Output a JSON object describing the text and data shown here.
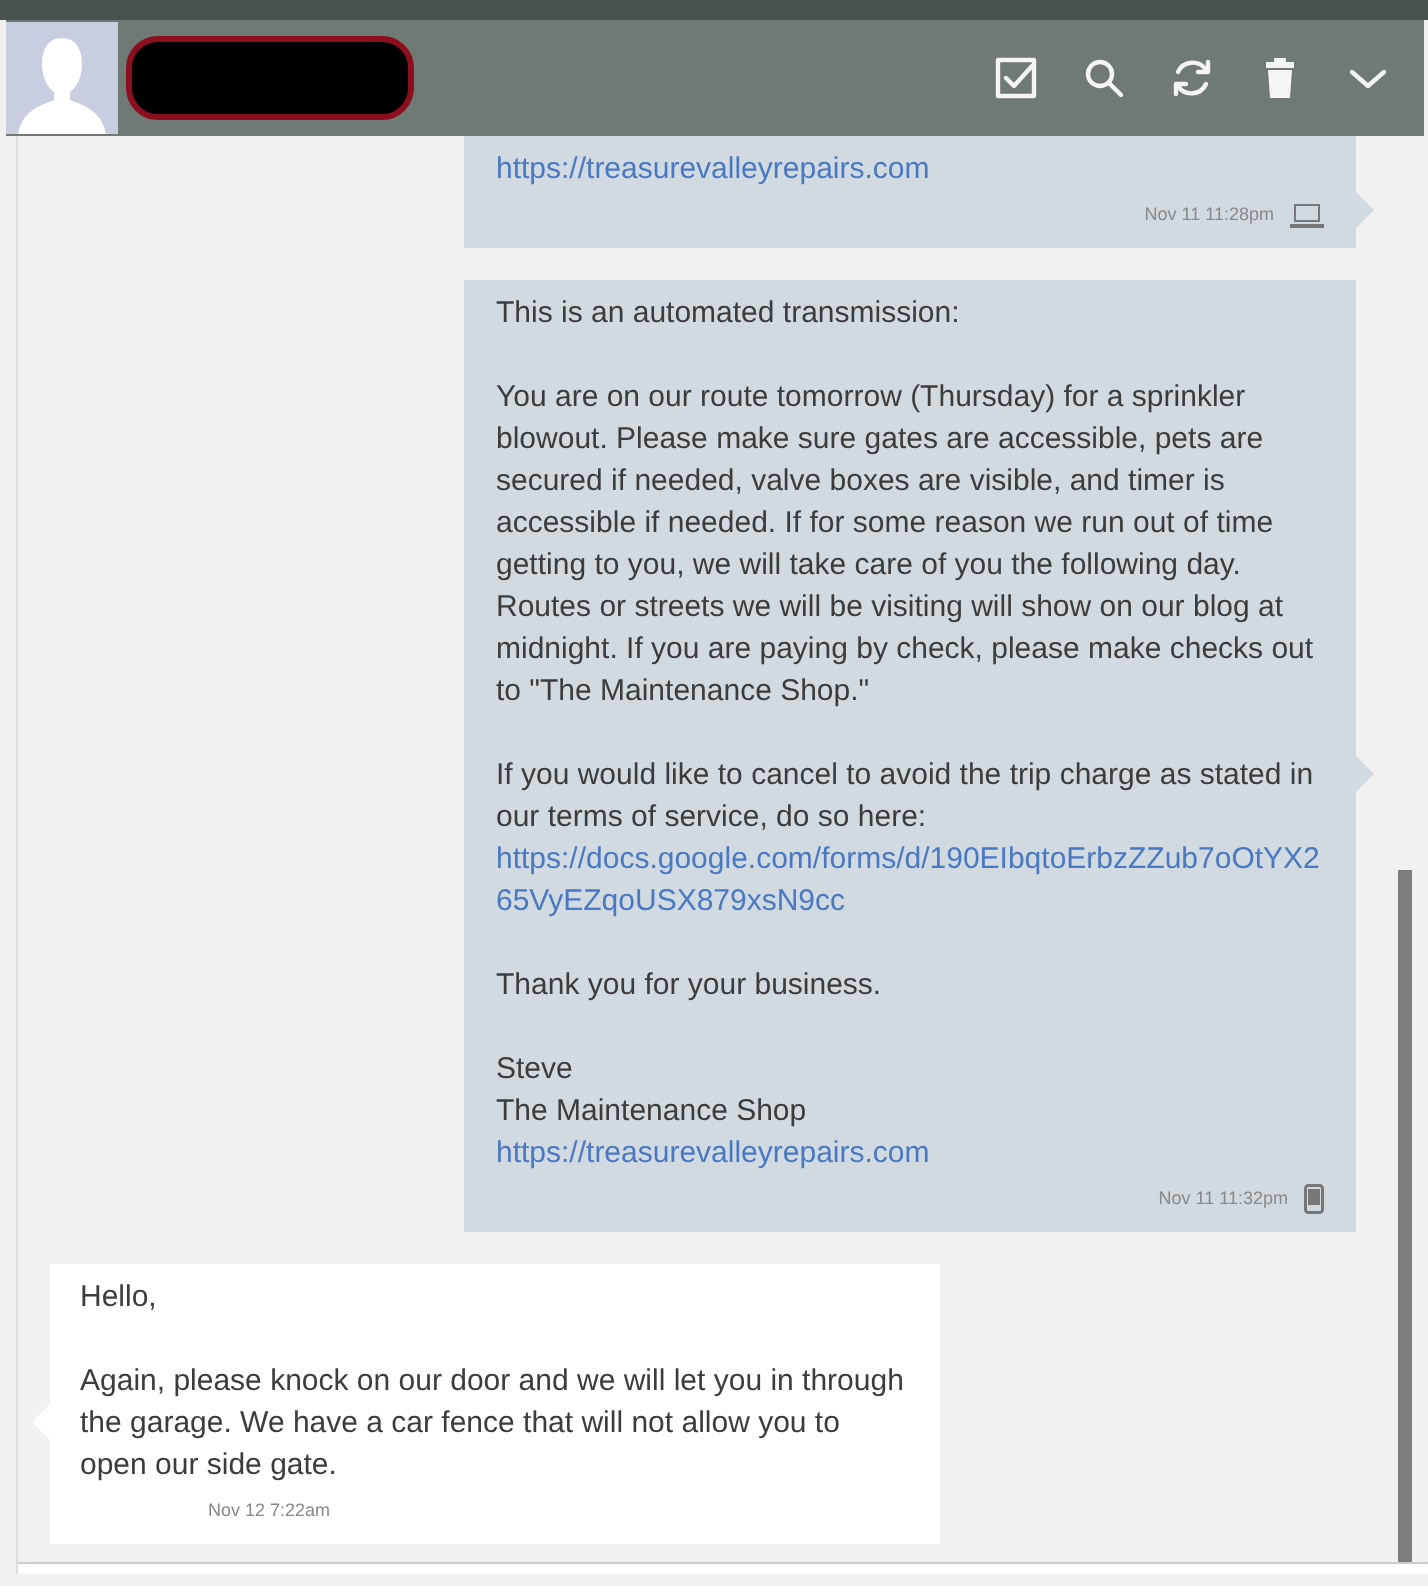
{
  "messages": [
    {
      "sent": true,
      "kind": "laptop",
      "paragraphs": [
        [
          {
            "kind": "link",
            "text": "https://treasurevalleyrepairs.com"
          }
        ]
      ],
      "time": "Nov 11 11:28pm"
    },
    {
      "sent": true,
      "kind": "phone",
      "paragraphs": [
        [
          {
            "kind": "text",
            "text": "This is an automated transmission:"
          }
        ],
        [
          {
            "kind": "text",
            "text": "You are on our route tomorrow (Thursday) for a sprinkler blowout. Please make sure gates are accessible, pets are secured if needed, valve boxes are visible, and timer is accessible if needed. If for some reason we run out of time getting to you, we will take care of you the following day. Routes or streets we will be visiting will show on our blog at midnight. If you are paying by check, please make checks out to \"The Maintenance Shop.\""
          }
        ],
        [
          {
            "kind": "text",
            "text": "If you would like to cancel to avoid the trip charge as stated in our terms of service, do so here:"
          },
          {
            "kind": "link",
            "text": "https://docs.google.com/forms/d/190EIbqtoErbzZZub7oOtYX265VyEZqoUSX879xsN9cc"
          }
        ],
        [
          {
            "kind": "text",
            "text": "Thank you for your business."
          }
        ],
        [
          {
            "kind": "text",
            "text": "Steve"
          },
          {
            "kind": "text",
            "text": "The Maintenance Shop"
          },
          {
            "kind": "link",
            "text": "https://treasurevalleyrepairs.com"
          }
        ]
      ],
      "time": "Nov 11 11:32pm"
    },
    {
      "sent": false,
      "kind": "plain",
      "paragraphs": [
        [
          {
            "kind": "text",
            "text": "Hello,"
          }
        ],
        [
          {
            "kind": "text",
            "text": "Again, please knock on our door and we will let you in through the garage. We have a car fence that will not allow you to open our side gate."
          }
        ]
      ],
      "time": "Nov 12 7:22am"
    }
  ]
}
